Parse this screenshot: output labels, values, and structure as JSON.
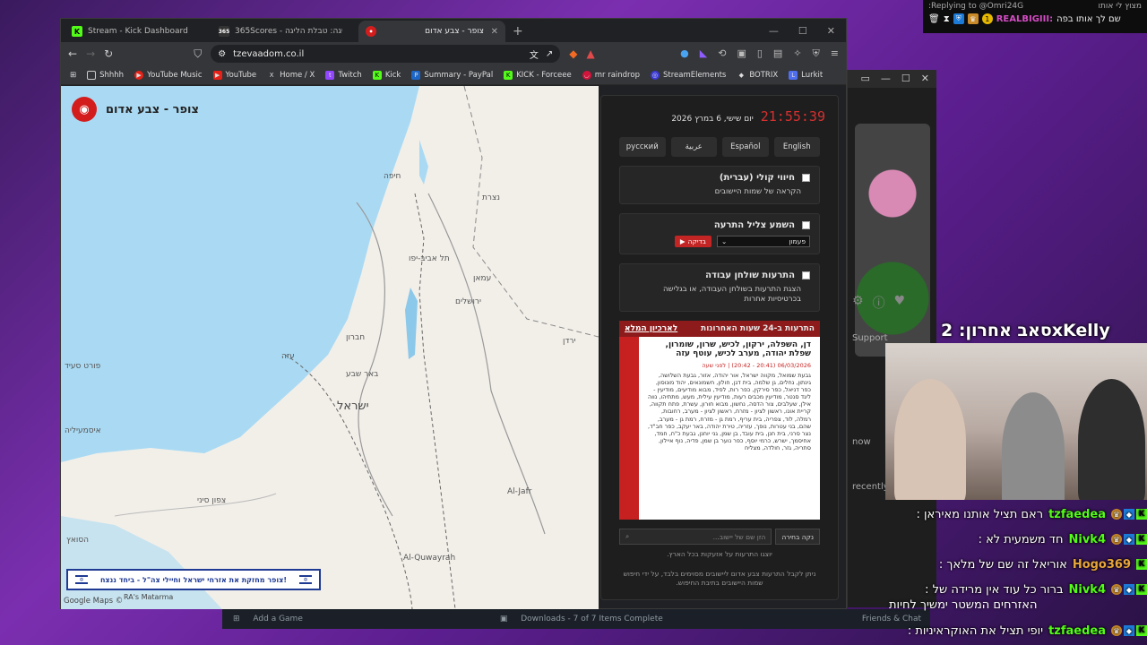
{
  "browser": {
    "tabs": [
      {
        "label": "Stream - Kick Dashboard",
        "icon": "kick-icon",
        "color": "#53fc18",
        "glyph": "K"
      },
      {
        "label": "365Scores - לה ליגה: טבלת הליגה",
        "icon": "365scores-icon",
        "color": "#555555",
        "glyph": "365"
      },
      {
        "label": "צופר - צבע אדום",
        "icon": "tzofar-icon",
        "color": "#d31d1d",
        "glyph": "•"
      }
    ],
    "url": "tzevaadom.co.il",
    "bookmarks": [
      {
        "label": "Shhhh",
        "icon": "folder-icon"
      },
      {
        "label": "YouTube Music",
        "icon": "youtube-music-icon"
      },
      {
        "label": "YouTube",
        "icon": "youtube-icon"
      },
      {
        "label": "Home / X",
        "icon": "x-icon"
      },
      {
        "label": "Twitch",
        "icon": "twitch-icon"
      },
      {
        "label": "Kick",
        "icon": "kick-icon"
      },
      {
        "label": "Summary - PayPal",
        "icon": "paypal-icon"
      },
      {
        "label": "KICK - Forceee",
        "icon": "kick-icon"
      },
      {
        "label": "mr raindrop",
        "icon": "raindrop-icon"
      },
      {
        "label": "StreamElements",
        "icon": "streamelements-icon"
      },
      {
        "label": "BOTRIX",
        "icon": "botrix-icon"
      },
      {
        "label": "Lurkit",
        "icon": "lurkit-icon"
      }
    ]
  },
  "site": {
    "title": "צופר - צבע אדום",
    "banner": "צופר מחזקת את אזרחי ישראל וחיילי צה\"ל - ביחד ננצח!",
    "map_labels": [
      {
        "text": "חיפה",
        "cls": ""
      },
      {
        "text": "נצרת",
        "cls": ""
      },
      {
        "text": "תל אביב-יפו",
        "cls": ""
      },
      {
        "text": "ירושלים",
        "cls": ""
      },
      {
        "text": "עמאן",
        "cls": ""
      },
      {
        "text": "ישראל",
        "cls": "big"
      },
      {
        "text": "באר שבע",
        "cls": ""
      },
      {
        "text": "פורט סעיד",
        "cls": ""
      },
      {
        "text": "איסמעיליה",
        "cls": ""
      },
      {
        "text": "הסואץ",
        "cls": ""
      },
      {
        "text": "חברון",
        "cls": ""
      },
      {
        "text": "עזה",
        "cls": ""
      },
      {
        "text": "צפון סיני",
        "cls": ""
      },
      {
        "text": "Al-Jafr",
        "cls": ""
      },
      {
        "text": "Al-Quwayrah",
        "cls": ""
      },
      {
        "text": "ירדן",
        "cls": ""
      }
    ],
    "google_label": "Google Maps ©",
    "attribution": "RA's Matarma"
  },
  "panel": {
    "clock": "21:55:39",
    "date": "יום שישי, 6 במרץ 2026",
    "languages": [
      "English",
      "Español",
      "عربية",
      "русский"
    ],
    "options": [
      {
        "title": "חיווי קולי (עברית)",
        "sub": "הקראה של שמות היישובים"
      },
      {
        "title": "השמע צליל התרעה",
        "sub": ""
      },
      {
        "title": "התרעות שולחן עבודה",
        "sub": "הצגת התרעות בשולחן העבודה, או בגלישה בכרטיסיות אחרות"
      }
    ],
    "sound_select": "פעמון",
    "test_button": "בדיקה",
    "alerts_header": "התרעות ב-24 שעות האחרונות",
    "archive_link": "לארכיון המלא",
    "alert": {
      "title": "דן, השפלה, ירקון, לכיש, שרון, שומרון, שפלת יהודה, מערב לכיש, עוטף עזה",
      "meta": "06/03/2026 (20:41 - 20:42) | לפני שעה",
      "body": "גבעת שמואל, מקווה ישראל, אור יהודה, אזור, גבעת השלושה, גינתון, נחלים, גן שלמה, בית דגן, חולון, חשמונאים, יהוד מונוסון, כפר דניאל, כפר סירקין, כפר רות, לפיד, מבוא מודיעים, מודיעין - ליגד סנטר, מודיעין מכבים רעות, מודיעין עילית, מעש, מתתיהו, נווה אילן, שעלבים, צור הדסה, נחשון, מבוא חורון, עשרת, פתח תקווה, קריית אונו, ראשון לציון - מזרח, ראשון לציון - מערב, רחובות, רמלה, לוד, צפריה, בית עריף, רמת גן - מזרח, רמת גן - מערב, שהם, בני עטרות, נופך, עזריה, טירת יהודה, באר יעקב, כפר חב\"ד, נצר סרני, בית חנן, בית עובד, בן שמן, גני יוחנן, גבעת כ\"ח, חמד, אחיסמך, ישרש, כרמי יוסף, כפר נוער בן שמן, פדיה, נוף איילון, סתריה, גזר, חולדה, מצליח"
    },
    "search_button": "נקה בחירה",
    "search_placeholder": "הזן שם של יישוב...",
    "note1": "יוצגו התרעות על אזעקות בכל הארץ.",
    "note2": "ניתן לקבל התרעות צבע אדום ליישובים מסוימים בלבד, על ידי חיפוש שמות היישובים בתיבת החיפוש."
  },
  "overlay": {
    "reply_to": "Replying to @Omri24G:",
    "reply_hint": "מצוץ לי אותו",
    "reply_user": "REALBIGIII:",
    "reply_msg": "שם לך אותו בפה",
    "last_sub": "סאב אחרון: 2xKelly",
    "chat": [
      {
        "user": "tzfaedea",
        "color": "#53fc18",
        "msg": "ראם תציל אותנו מאיראן :"
      },
      {
        "user": "Nivk4",
        "color": "#53fc18",
        "msg": "חד משמעית לא :"
      },
      {
        "user": "Hogo369",
        "color": "#e8a53a",
        "msg": "אוריאל זה שם של מלאך :"
      },
      {
        "user": "Nivk4",
        "color": "#53fc18",
        "msg": "ברור כל עוד אין מרידה של :"
      }
    ],
    "chat_cont": "האזרחים המשטר ימשיך לחיות",
    "chat_last_user": "tzfaedea",
    "chat_last_msg": "יופי תציל את האוקראיניות :"
  },
  "background": {
    "steam_add_game": "Add a Game",
    "steam_downloads": "Downloads - 7 of 7 Items Complete",
    "steam_friends": "Friends & Chat",
    "support": "Support",
    "now": "now",
    "recently": "recently"
  }
}
